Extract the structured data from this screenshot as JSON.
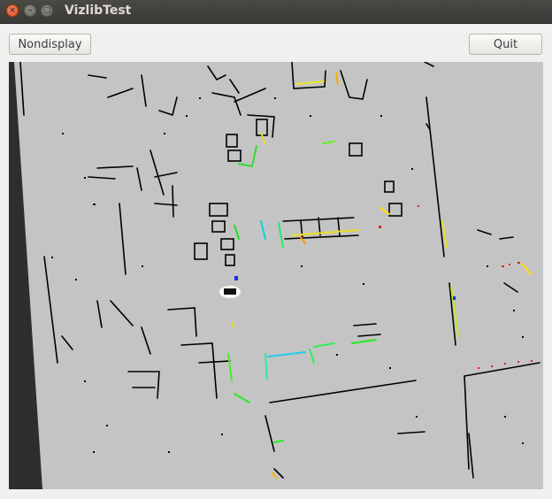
{
  "window": {
    "title": "VizlibTest",
    "controls": {
      "close_glyph": "×",
      "minimize_glyph": "–",
      "maximize_glyph": "□"
    }
  },
  "toolbar": {
    "nondisplay_label": "Nondisplay",
    "quit_label": "Quit"
  },
  "map_view": {
    "background_color": "#c4c4c4",
    "wall_color": "#000000",
    "border_color": "#2e2e2e",
    "robot_marker": "robot-icon"
  }
}
